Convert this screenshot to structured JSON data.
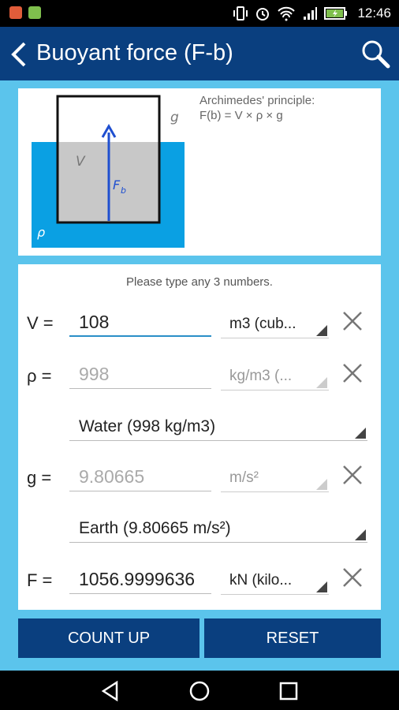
{
  "status_bar": {
    "time": "12:46"
  },
  "app_bar": {
    "title": "Buoyant force (F-b)"
  },
  "diagram": {
    "formula_line1": "Archimedes' principle:",
    "formula_line2": "F(b) = V × ρ × g",
    "label_g": "g",
    "label_V": "V",
    "label_F": "F",
    "label_F_sub": "b",
    "label_rho": "ρ"
  },
  "form": {
    "hint": "Please type any 3 numbers.",
    "volume": {
      "label": "V =",
      "value": "108",
      "unit": "m3 (cub..."
    },
    "density": {
      "label": "ρ =",
      "value": "998",
      "unit": "kg/m3 (...",
      "preset": "Water (998 kg/m3)"
    },
    "gravity": {
      "label": "g =",
      "value": "9.80665",
      "unit": "m/s²",
      "preset": "Earth (9.80665 m/s²)"
    },
    "force": {
      "label": "F =",
      "value": "1056.9999636",
      "unit": "kN (kilo..."
    }
  },
  "buttons": {
    "count_up": "COUNT UP",
    "reset": "RESET"
  },
  "colors": {
    "app_bar": "#0a3f7f",
    "background": "#5bc4ec",
    "water": "#0aa0e3",
    "accent": "#2a8fc7",
    "arrow": "#1f4fd0"
  }
}
